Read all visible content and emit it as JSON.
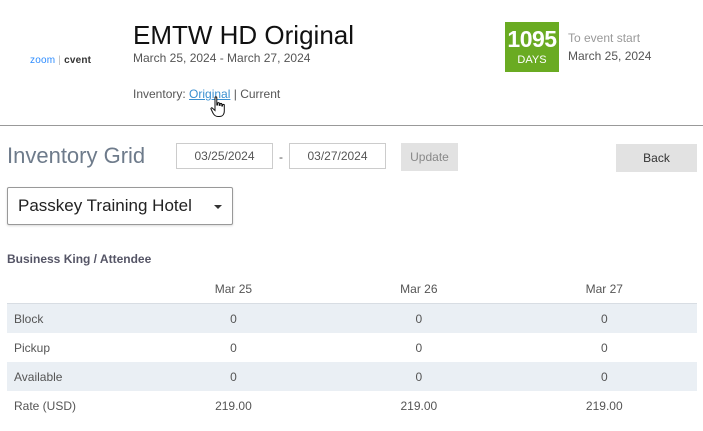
{
  "brand": {
    "zoom": "zoom",
    "separator": "|",
    "cvent": "cvent"
  },
  "event": {
    "title": "EMTW HD Original",
    "dates": "March 25, 2024 - March 27, 2024",
    "inventory_label": "Inventory:",
    "inventory_original": "Original",
    "inventory_separator": "|",
    "inventory_current": "Current"
  },
  "countdown": {
    "days": "1095",
    "days_label": "DAYS",
    "to_event_label": "To event start",
    "start_date": "March 25, 2024",
    "badge_color": "#6aab22"
  },
  "grid": {
    "title": "Inventory Grid",
    "start_date": "03/25/2024",
    "date_separator": "-",
    "end_date": "03/27/2024",
    "update_label": "Update",
    "back_label": "Back",
    "hotel": "Passkey Training Hotel",
    "room_type": "Business King / Attendee",
    "columns": [
      "",
      "Mar 25",
      "Mar 26",
      "Mar 27"
    ],
    "rows": [
      {
        "label": "Block",
        "values": [
          "0",
          "0",
          "0"
        ]
      },
      {
        "label": "Pickup",
        "values": [
          "0",
          "0",
          "0"
        ]
      },
      {
        "label": "Available",
        "values": [
          "0",
          "0",
          "0"
        ]
      },
      {
        "label": "Rate (USD)",
        "values": [
          "219.00",
          "219.00",
          "219.00"
        ]
      }
    ]
  }
}
